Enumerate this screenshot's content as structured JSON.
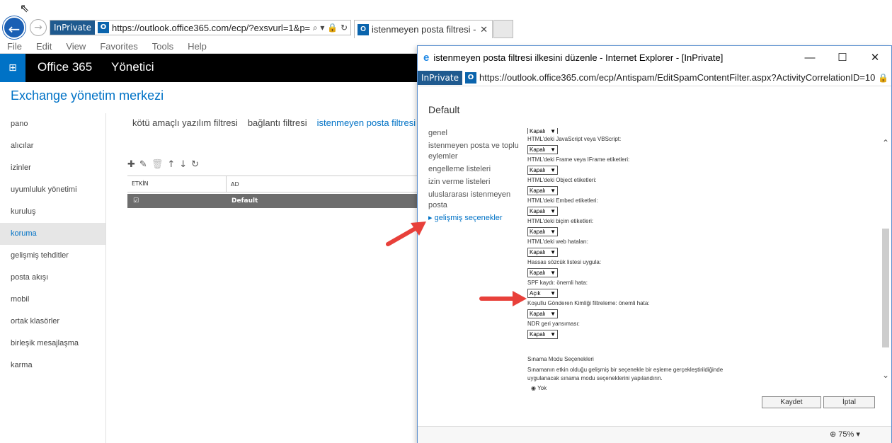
{
  "browser": {
    "inprivate": "InPrivate",
    "url": "https://outlook.office365.com/ecp/?exsvurl=1&p=",
    "address_icons": "⌕ ▾ 🔒 ↻",
    "tab_title": "istenmeyen posta filtresi - ...",
    "menu": [
      "File",
      "Edit",
      "View",
      "Favorites",
      "Tools",
      "Help"
    ]
  },
  "o365": {
    "title": "Office 365",
    "admin": "Yönetici",
    "eac_title": "Exchange yönetim merkezi"
  },
  "leftnav": [
    "pano",
    "alıcılar",
    "izinler",
    "uyumluluk yönetimi",
    "kuruluş",
    "koruma",
    "gelişmiş tehditler",
    "posta akışı",
    "mobil",
    "ortak klasörler",
    "birleşik mesajlaşma",
    "karma"
  ],
  "selected_nav": "koruma",
  "subtabs": [
    "kötü amaçlı yazılım filtresi",
    "bağlantı filtresi",
    "istenmeyen posta filtresi"
  ],
  "table": {
    "col1": "ETKİN",
    "col2": "AD",
    "row_name": "Default"
  },
  "popup": {
    "title": "istenmeyen posta filtresi ilkesini düzenle - Internet Explorer - [InPrivate]",
    "inprivate": "InPrivate",
    "url": "https://outlook.office365.com/ecp/Antispam/EditSpamContentFilter.aspx?ActivityCorrelationID=1077892c-",
    "heading": "Default",
    "nav": [
      "genel",
      "istenmeyen posta ve toplu eylemler",
      "engelleme listeleri",
      "izin verme listeleri",
      "uluslararası istenmeyen posta",
      "gelişmiş seçenekler"
    ],
    "settings": [
      {
        "label": "HTML'deki JavaScript veya VBScript:",
        "value": "Kapalı"
      },
      {
        "label": "HTML'deki Frame veya IFrame etiketleri:",
        "value": "Kapalı"
      },
      {
        "label": "HTML'deki Object etiketleri:",
        "value": "Kapalı"
      },
      {
        "label": "HTML'deki Embed etiketleri:",
        "value": "Kapalı"
      },
      {
        "label": "HTML'deki biçim etiketleri:",
        "value": "Kapalı"
      },
      {
        "label": "HTML'deki web hataları:",
        "value": "Kapalı"
      },
      {
        "label": "Hassas sözcük listesi uygula:",
        "value": "Kapalı"
      },
      {
        "label": "SPF kaydı: önemli hata:",
        "value": "Açık"
      },
      {
        "label": "Koşullu Gönderen Kimliği filtreleme: önemli hata:",
        "value": "Kapalı"
      },
      {
        "label": "NDR geri yansıması:",
        "value": "Kapalı"
      }
    ],
    "first_value": "Kapalı",
    "test_heading": "Sınama Modu Seçenekleri",
    "test_desc": "Sınamanın etkin olduğu gelişmiş bir seçenekle bir eşleme gerçekleştirildiğinde uygulanacak sınama modu seçeneklerini yapılandırın.",
    "radio": "Yok",
    "save": "Kaydet",
    "cancel": "İptal",
    "zoom": "75%"
  },
  "colors": {
    "accent": "#0072c6",
    "arrow": "#e8403a"
  }
}
